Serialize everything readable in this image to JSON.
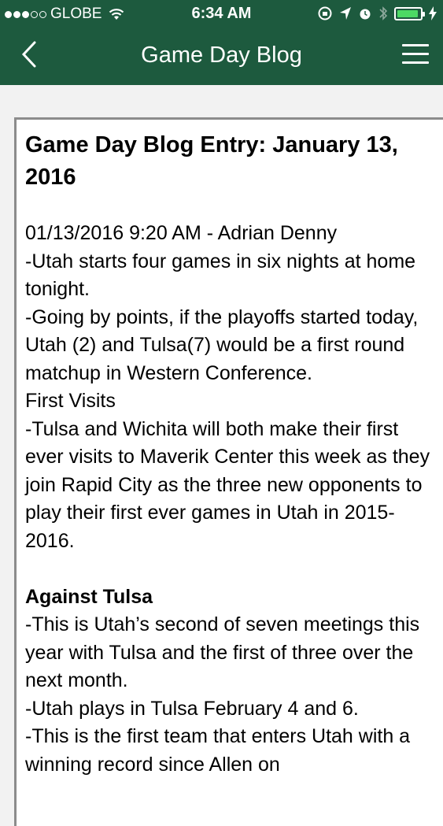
{
  "status_bar": {
    "carrier": "GLOBE",
    "time": "6:34 AM"
  },
  "nav": {
    "title": "Game Day Blog"
  },
  "post": {
    "title": "Game Day Blog Entry: January 13, 2016",
    "byline": "01/13/2016 9:20 AM - Adrian Denny",
    "paragraph_1": "-Utah starts four games in six nights at home tonight.",
    "paragraph_2": "-Going by points, if the playoffs started today, Utah (2) and Tulsa(7) would be a first round matchup in Western Conference.",
    "section_1_heading": "First Visits",
    "paragraph_3": "-Tulsa and Wichita will both make their first ever visits to Maverik Center this week as they join Rapid City as the three new opponents to play their first ever games in Utah in 2015-2016.",
    "section_2_heading": "Against Tulsa",
    "paragraph_4": "-This is Utah’s second of seven meetings this year with Tulsa and the first of three over the next month.",
    "paragraph_5": "-Utah plays in Tulsa February 4 and 6.",
    "paragraph_6": "-This is the first team that enters Utah with a winning record since Allen on"
  }
}
